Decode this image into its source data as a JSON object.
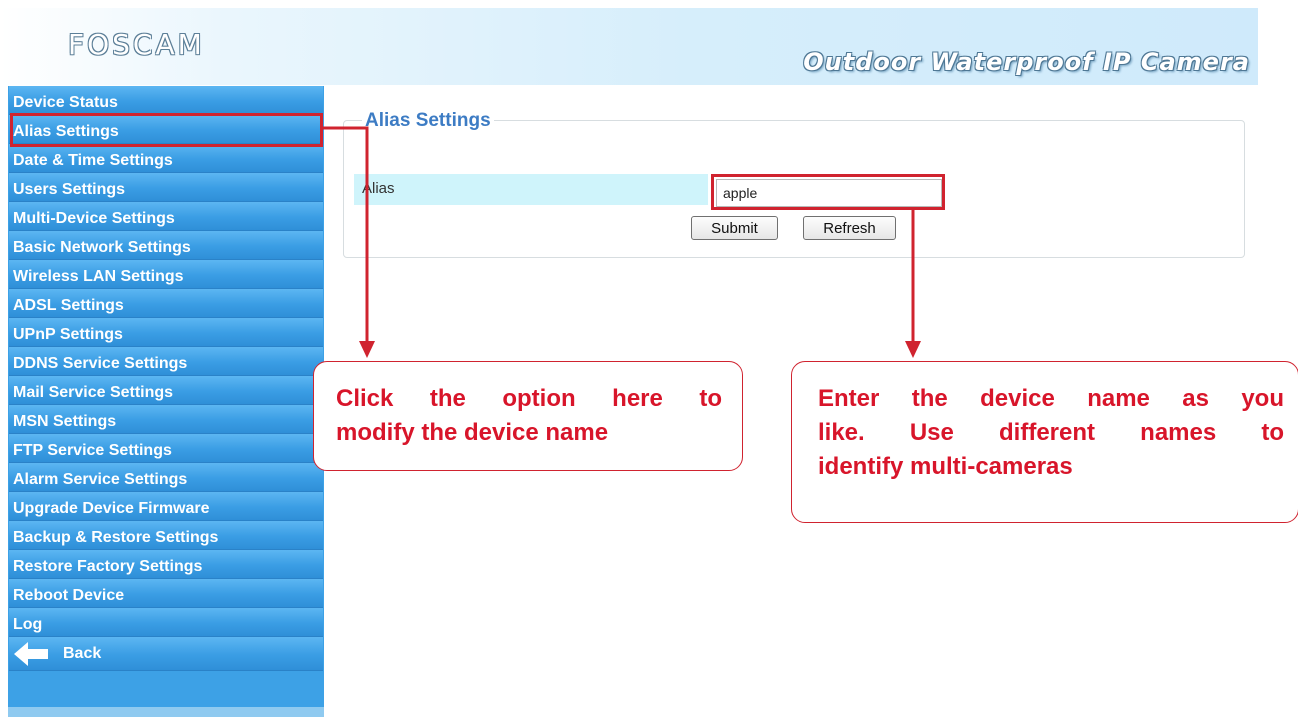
{
  "header": {
    "logo": "FOSCAM",
    "tagline": "Outdoor Waterproof IP Camera"
  },
  "sidebar": {
    "items": [
      {
        "label": "Device Status"
      },
      {
        "label": "Alias Settings"
      },
      {
        "label": "Date & Time Settings"
      },
      {
        "label": "Users Settings"
      },
      {
        "label": "Multi-Device Settings"
      },
      {
        "label": "Basic Network Settings"
      },
      {
        "label": "Wireless LAN Settings"
      },
      {
        "label": "ADSL Settings"
      },
      {
        "label": "UPnP Settings"
      },
      {
        "label": "DDNS Service Settings"
      },
      {
        "label": "Mail Service Settings"
      },
      {
        "label": "MSN Settings"
      },
      {
        "label": "FTP Service Settings"
      },
      {
        "label": "Alarm Service Settings"
      },
      {
        "label": "Upgrade Device Firmware"
      },
      {
        "label": "Backup & Restore Settings"
      },
      {
        "label": "Restore Factory Settings"
      },
      {
        "label": "Reboot Device"
      },
      {
        "label": "Log"
      }
    ],
    "back_label": "Back",
    "back_icon": "back-arrow-icon"
  },
  "alias_panel": {
    "legend": "Alias Settings",
    "field_label": "Alias",
    "field_value": "apple",
    "submit_label": "Submit",
    "refresh_label": "Refresh"
  },
  "annotations": {
    "left_callout": [
      "Click the option here to",
      "modify the device name"
    ],
    "right_callout": [
      "Enter the device name as you",
      "like. Use different names to",
      "identify multi-cameras"
    ]
  },
  "colors": {
    "sidebar_blue": "#3a9de4",
    "highlight_red": "#d0232f",
    "legend_blue": "#3d7cc4",
    "label_cell": "#cff4fb"
  }
}
